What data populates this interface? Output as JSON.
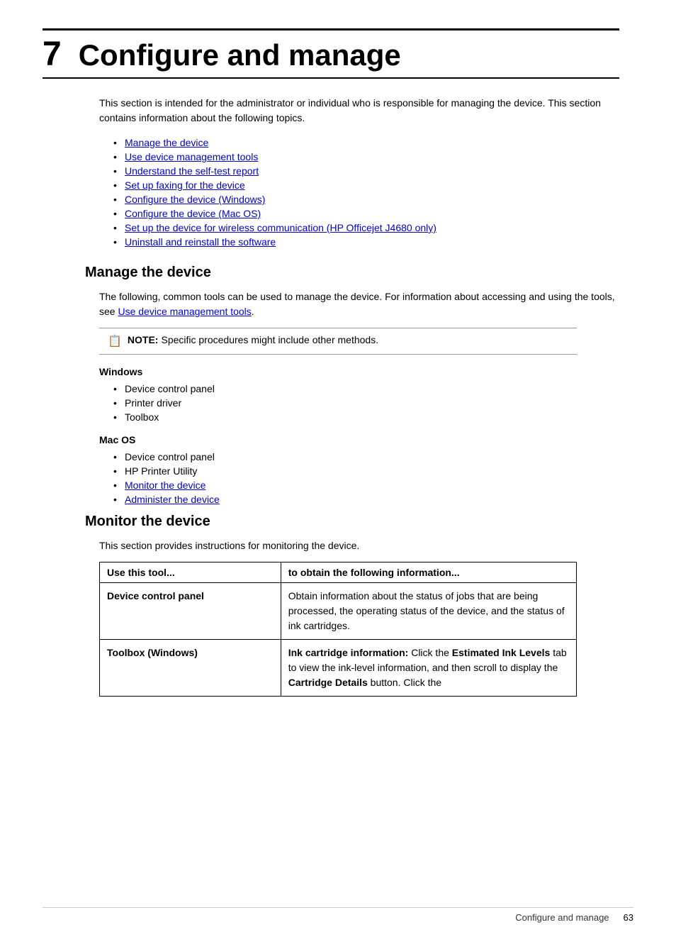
{
  "page": {
    "chapter_number": "7",
    "chapter_title": "Configure and manage",
    "intro_paragraph": "This section is intended for the administrator or individual who is responsible for managing the device. This section contains information about the following topics.",
    "toc_links": [
      {
        "label": "Manage the device",
        "href": "#manage"
      },
      {
        "label": "Use device management tools",
        "href": "#tools"
      },
      {
        "label": "Understand the self-test report",
        "href": "#selftest"
      },
      {
        "label": "Set up faxing for the device",
        "href": "#faxing"
      },
      {
        "label": "Configure the device (Windows)",
        "href": "#configwin"
      },
      {
        "label": "Configure the device (Mac OS)",
        "href": "#configmac"
      },
      {
        "label": "Set up the device for wireless communication (HP Officejet J4680 only)",
        "href": "#wireless"
      },
      {
        "label": "Uninstall and reinstall the software",
        "href": "#uninstall"
      }
    ],
    "manage_section": {
      "heading": "Manage the device",
      "description_part1": "The following, common tools can be used to manage the device. For information about accessing and using the tools, see ",
      "description_link": "Use device management tools",
      "description_part2": ".",
      "note_label": "NOTE:",
      "note_text": "Specific procedures might include other methods.",
      "windows_heading": "Windows",
      "windows_items": [
        "Device control panel",
        "Printer driver",
        "Toolbox"
      ],
      "macos_heading": "Mac OS",
      "macos_items": [
        {
          "label": "Device control panel",
          "is_link": false
        },
        {
          "label": "HP Printer Utility",
          "is_link": false
        },
        {
          "label": "Monitor the device",
          "is_link": true
        },
        {
          "label": "Administer the device",
          "is_link": true
        }
      ]
    },
    "monitor_section": {
      "heading": "Monitor the device",
      "description": "This section provides instructions for monitoring the device.",
      "table": {
        "col1_header": "Use this tool...",
        "col2_header": "to obtain the following information...",
        "rows": [
          {
            "col1": "Device control panel",
            "col2": "Obtain information about the status of jobs that are being processed, the operating status of the device, and the status of ink cartridges."
          },
          {
            "col1": "Toolbox (Windows)",
            "col2_parts": [
              {
                "bold": true,
                "text": "Ink cartridge information: "
              },
              {
                "bold": false,
                "text": "Click the "
              },
              {
                "bold": true,
                "text": "Estimated Ink Levels"
              },
              {
                "bold": false,
                "text": " tab to view the ink-level information, and then scroll to display the "
              },
              {
                "bold": true,
                "text": "Cartridge Details"
              },
              {
                "bold": false,
                "text": " button. Click the"
              }
            ]
          }
        ]
      }
    },
    "footer": {
      "section_name": "Configure and manage",
      "page_number": "63"
    }
  }
}
